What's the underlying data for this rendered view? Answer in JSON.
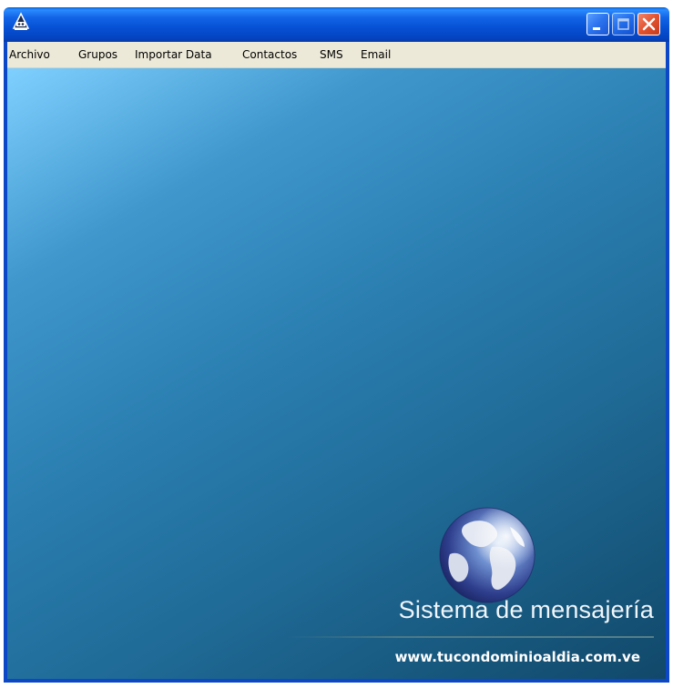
{
  "window": {
    "icon": "app-logo-icon",
    "buttons": {
      "minimize": "minimize-icon",
      "maximize": "maximize-icon",
      "close": "close-icon"
    }
  },
  "menu": {
    "items": [
      {
        "label": "Archivo"
      },
      {
        "label": "Grupos"
      },
      {
        "label": "Importar Data"
      },
      {
        "label": "Contactos"
      },
      {
        "label": "SMS"
      },
      {
        "label": "Email"
      }
    ]
  },
  "splash": {
    "title": "Sistema de mensajería",
    "url": "www.tucondominioaldia.com.ve",
    "logo_icon": "globe-icon"
  },
  "colors": {
    "titlebar": "#0650d4",
    "menubar": "#ece9d8",
    "background_light": "#7fd0ff",
    "background_dark": "#11486a"
  }
}
